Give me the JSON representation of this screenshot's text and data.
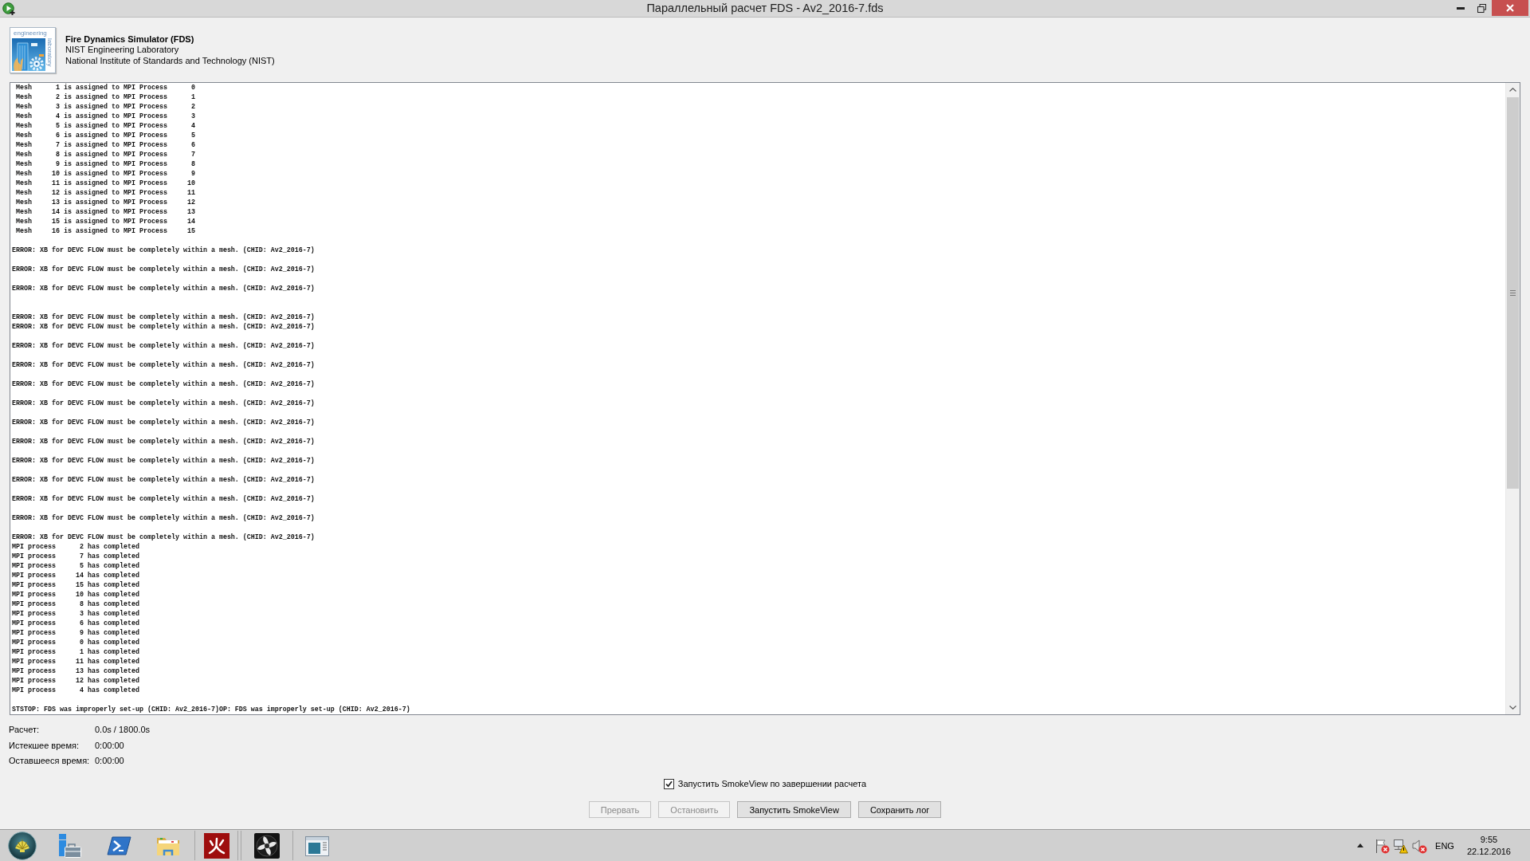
{
  "window": {
    "title": "Параллельный расчет FDS - Av2_2016-7.fds"
  },
  "header": {
    "logo": {
      "caption": "engineering",
      "side_caption": "laboratory"
    },
    "title": "Fire Dynamics Simulator (FDS)",
    "lines": [
      "NIST Engineering Laboratory",
      "National Institute of Standards and Technology (NIST)"
    ]
  },
  "log": {
    "blocks": [
      {
        "kind": "plain",
        "lines": [
          " Mesh      1 is assigned to MPI Process      0",
          " Mesh      2 is assigned to MPI Process      1",
          " Mesh      3 is assigned to MPI Process      2",
          " Mesh      4 is assigned to MPI Process      3",
          " Mesh      5 is assigned to MPI Process      4",
          " Mesh      6 is assigned to MPI Process      5",
          " Mesh      7 is assigned to MPI Process      6",
          " Mesh      8 is assigned to MPI Process      7",
          " Mesh      9 is assigned to MPI Process      8",
          " Mesh     10 is assigned to MPI Process      9",
          " Mesh     11 is assigned to MPI Process     10",
          " Mesh     12 is assigned to MPI Process     11",
          " Mesh     13 is assigned to MPI Process     12",
          " Mesh     14 is assigned to MPI Process     13",
          " Mesh     15 is assigned to MPI Process     14",
          " Mesh     16 is assigned to MPI Process     15"
        ]
      },
      {
        "kind": "spaced",
        "lines": [
          "ERROR: XB for DEVC FLOW must be completely within a mesh. (CHID: Av2_2016-7)"
        ]
      },
      {
        "kind": "spaced",
        "lines": [
          "ERROR: XB for DEVC FLOW must be completely within a mesh. (CHID: Av2_2016-7)"
        ]
      },
      {
        "kind": "spaced",
        "lines": [
          "ERROR: XB for DEVC FLOW must be completely within a mesh. (CHID: Av2_2016-7)"
        ]
      },
      {
        "kind": "double_spaced",
        "lines": [
          "ERROR: XB for DEVC FLOW must be completely within a mesh. (CHID: Av2_2016-7)",
          "ERROR: XB for DEVC FLOW must be completely within a mesh. (CHID: Av2_2016-7)"
        ]
      },
      {
        "kind": "spaced",
        "lines": [
          "ERROR: XB for DEVC FLOW must be completely within a mesh. (CHID: Av2_2016-7)"
        ]
      },
      {
        "kind": "spaced",
        "lines": [
          "ERROR: XB for DEVC FLOW must be completely within a mesh. (CHID: Av2_2016-7)"
        ]
      },
      {
        "kind": "spaced",
        "lines": [
          "ERROR: XB for DEVC FLOW must be completely within a mesh. (CHID: Av2_2016-7)"
        ]
      },
      {
        "kind": "spaced",
        "lines": [
          "ERROR: XB for DEVC FLOW must be completely within a mesh. (CHID: Av2_2016-7)"
        ]
      },
      {
        "kind": "spaced",
        "lines": [
          "ERROR: XB for DEVC FLOW must be completely within a mesh. (CHID: Av2_2016-7)"
        ]
      },
      {
        "kind": "spaced",
        "lines": [
          "ERROR: XB for DEVC FLOW must be completely within a mesh. (CHID: Av2_2016-7)"
        ]
      },
      {
        "kind": "spaced",
        "lines": [
          "ERROR: XB for DEVC FLOW must be completely within a mesh. (CHID: Av2_2016-7)"
        ]
      },
      {
        "kind": "spaced",
        "lines": [
          "ERROR: XB for DEVC FLOW must be completely within a mesh. (CHID: Av2_2016-7)"
        ]
      },
      {
        "kind": "spaced",
        "lines": [
          "ERROR: XB for DEVC FLOW must be completely within a mesh. (CHID: Av2_2016-7)"
        ]
      },
      {
        "kind": "spaced",
        "lines": [
          "ERROR: XB for DEVC FLOW must be completely within a mesh. (CHID: Av2_2016-7)"
        ]
      },
      {
        "kind": "spaced",
        "lines": [
          "ERROR: XB for DEVC FLOW must be completely within a mesh. (CHID: Av2_2016-7)",
          "MPI process      2 has completed",
          "MPI process      7 has completed",
          "MPI process      5 has completed",
          "MPI process     14 has completed",
          "MPI process     15 has completed",
          "MPI process     10 has completed",
          "MPI process      8 has completed",
          "MPI process      3 has completed",
          "MPI process      6 has completed",
          "MPI process      9 has completed",
          "MPI process      0 has completed",
          "MPI process      1 has completed",
          "MPI process     11 has completed",
          "MPI process     13 has completed",
          "MPI process     12 has completed",
          "MPI process      4 has completed"
        ]
      },
      {
        "kind": "spaced",
        "lines": [
          "STSTOP: FDS was improperly set-up (CHID: Av2_2016-7)OP: FDS was improperly set-up (CHID: Av2_2016-7)"
        ]
      }
    ]
  },
  "status": [
    {
      "label": "Расчет:",
      "value": "0.0s / 1800.0s"
    },
    {
      "label": "Истекшее время:",
      "value": "0:00:00"
    },
    {
      "label": "Оставшееся время:",
      "value": "0:00:00"
    }
  ],
  "option": {
    "label": "Запустить SmokeView по завершении расчета",
    "checked": true
  },
  "buttons": [
    {
      "label": "Прервать",
      "disabled": true
    },
    {
      "label": "Остановить",
      "disabled": true
    },
    {
      "label": "Запустить SmokeView",
      "disabled": false
    },
    {
      "label": "Сохранить лог",
      "disabled": false
    }
  ],
  "taskbar": {
    "tray": {
      "language": "ENG",
      "time": "9:55",
      "date": "22.12.2016"
    }
  }
}
